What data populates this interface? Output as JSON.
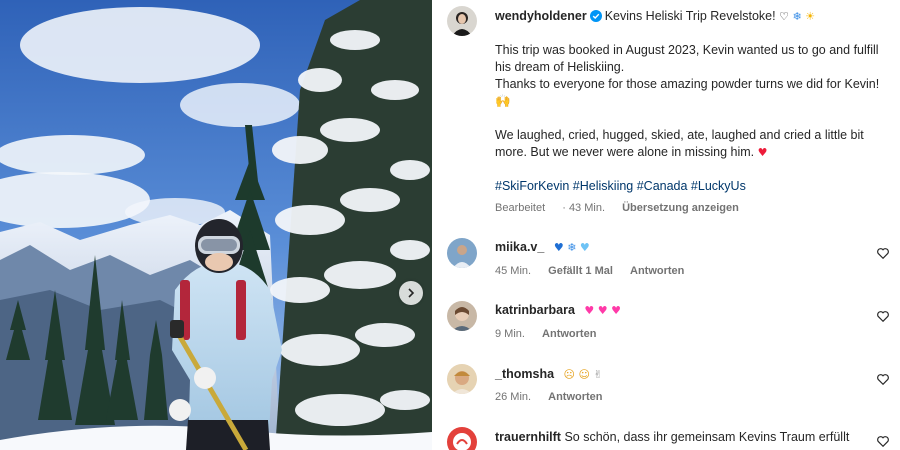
{
  "post": {
    "author": "wendyholdener",
    "title": "Kevins Heliski Trip Revelstoke!",
    "title_emojis": [
      "♡",
      "❄",
      "☀"
    ],
    "caption_p1": "This trip was booked in August 2023, Kevin wanted us to go and fulfill his dream of Heliskiing.",
    "caption_p2": "Thanks to everyone for those amazing powder turns we did for Kevin! 🙌",
    "caption_p3": "We laughed, cried, hugged, skied, ate, laughed and cried a little bit more. But we never were alone in missing him.",
    "caption_p3_emoji": "♥",
    "hashtags": "#SkiForKevin #Heliskiing #Canada #LuckyUs",
    "edited_label": "Bearbeitet",
    "time": "43 Min.",
    "translate_label": "Übersetzung anzeigen"
  },
  "comments": [
    {
      "user": "miika.v_",
      "emojis": [
        "♥",
        "❄",
        "♥"
      ],
      "time": "45 Min.",
      "likes": "Gefällt 1 Mal",
      "reply": "Antworten"
    },
    {
      "user": "katrinbarbara",
      "emojis": [
        "♥",
        "♥",
        "♥"
      ],
      "time": "9 Min.",
      "reply": "Antworten"
    },
    {
      "user": "_thomsha",
      "emojis": [
        "☹",
        "☺",
        "✌"
      ],
      "time": "26 Min.",
      "reply": "Antworten"
    },
    {
      "user": "trauernhilft",
      "text": "So schön, dass ihr gemeinsam Kevins Traum erfüllt"
    }
  ],
  "icons": {
    "carousel_next": "chevron-right-icon",
    "like": "heart-outline-icon",
    "verified": "verified-badge-icon"
  },
  "colors": {
    "text": "#262626",
    "secondary": "#737373",
    "hashtag": "#00376b",
    "verified": "#0095f6"
  }
}
